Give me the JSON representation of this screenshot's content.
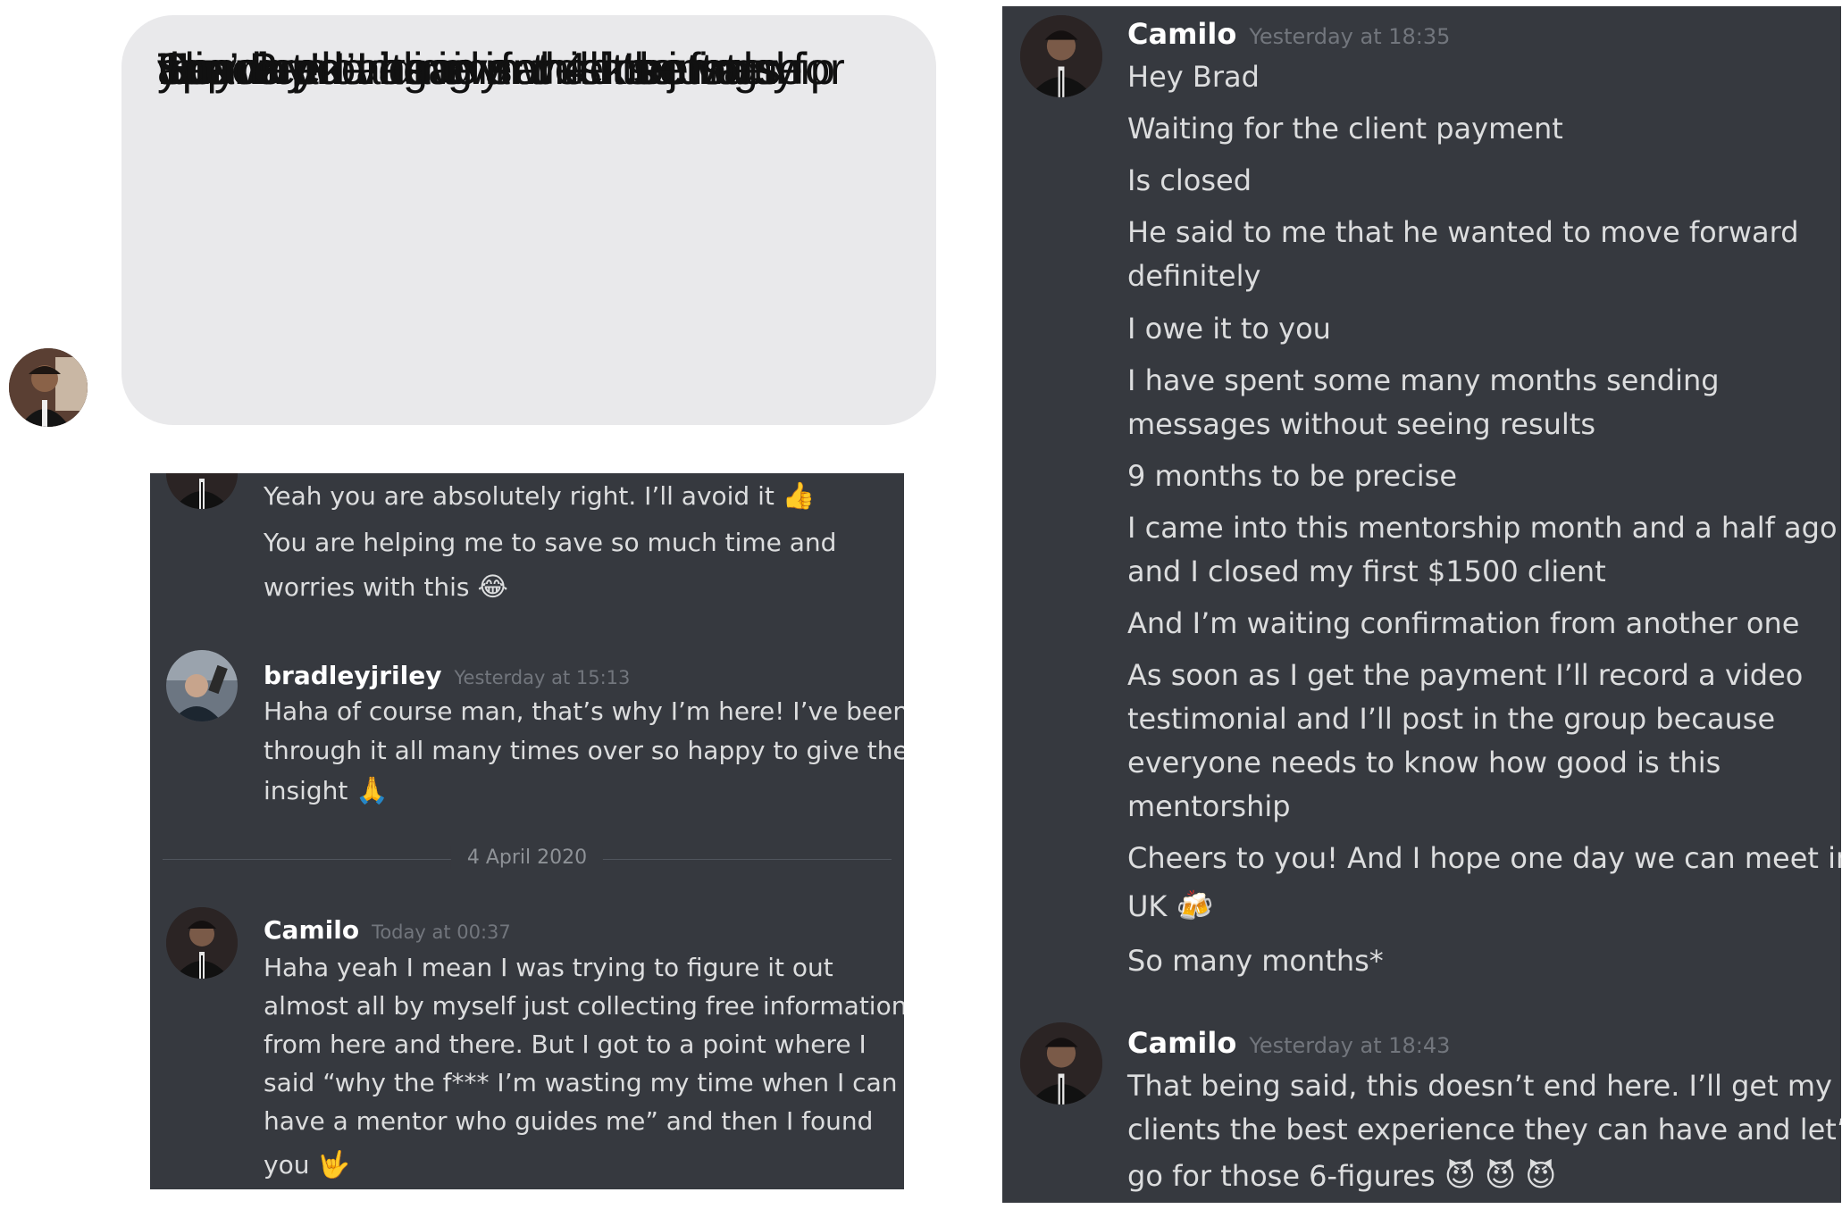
{
  "imessage": {
    "lines": [
      "Hey Brad I have set 4 meetings for",
      "this week already and it’s just",
      "Sunday! I’ve never had so many",
      "appointments in a week before.",
      "Thank you again for all the value",
      "you’re providing in this mentorship"
    ]
  },
  "discord_left": {
    "msg1": {
      "lines": [
        "Yeah you are absolutely right. I’ll avoid it",
        "You are helping me to save so much time and",
        "worries with this"
      ],
      "emojis": [
        "👍",
        "😂"
      ]
    },
    "msg2": {
      "username": "bradleyjriley",
      "timestamp": "Yesterday at 15:13",
      "lines": [
        "Haha of course man, that’s why I’m here! I’ve been",
        "through it all many times over so happy to give the",
        "insight"
      ],
      "emoji": "🙏"
    },
    "date_divider": "4 April 2020",
    "msg3": {
      "username": "Camilo",
      "timestamp": "Today at 00:37",
      "lines": [
        "Haha yeah I mean I was trying to figure it out",
        "almost all by myself just collecting free information",
        "from here and there. But I got to a point where I",
        "said “why the f*** I’m wasting my time when I can",
        "have a mentor who guides me” and then I found",
        "you"
      ],
      "emoji": "🤟"
    }
  },
  "discord_right": {
    "msg1": {
      "username": "Camilo",
      "timestamp": "Yesterday at 18:35",
      "lines": [
        "Hey Brad",
        "Waiting for the client payment",
        "Is closed",
        "He said to me that he wanted to move forward",
        "definitely",
        "I owe it to you",
        "I have spent some many months sending",
        "messages without seeing results",
        "9 months to be precise",
        "I came into this mentorship month and a half ago",
        "and I closed my first $1500 client",
        "And I’m waiting confirmation from another one",
        "As soon as I get the payment I’ll record a video",
        "testimonial and I’ll post in the group because",
        "everyone needs to know how good is this",
        "mentorship",
        "Cheers to you! And I hope one day we can meet in",
        "UK",
        "So many months*"
      ],
      "emoji": "🍻"
    },
    "msg2": {
      "username": "Camilo",
      "timestamp": "Yesterday at 18:43",
      "lines": [
        "That being said, this doesn’t end here. I’ll get my",
        "clients the best experience they can have and let’s",
        "go for those 6-figures"
      ],
      "emoji": "😈"
    }
  },
  "colors": {
    "discord_bg": "#36393f",
    "discord_text": "#dcddde",
    "discord_username": "#ffffff",
    "discord_timestamp": "#72767d",
    "imessage_bubble": "#e9e9eb"
  }
}
